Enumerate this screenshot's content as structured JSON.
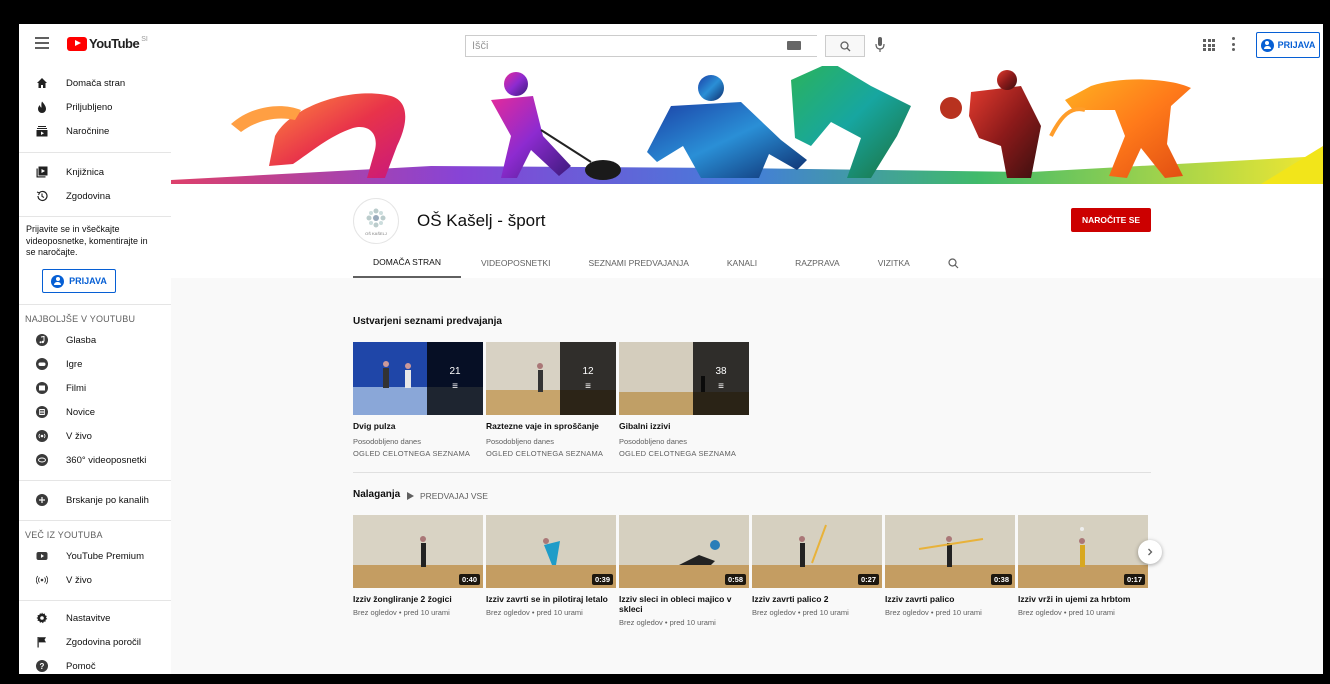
{
  "topbar": {
    "logo_text": "YouTube",
    "logo_sup": "SI",
    "search_placeholder": "Išči",
    "signin_label": "PRIJAVA"
  },
  "sidebar": {
    "main": [
      {
        "label": "Domača stran",
        "icon": "home-icon"
      },
      {
        "label": "Priljubljeno",
        "icon": "trending-icon"
      },
      {
        "label": "Naročnine",
        "icon": "subscriptions-icon"
      }
    ],
    "library": [
      {
        "label": "Knjižnica",
        "icon": "library-icon"
      },
      {
        "label": "Zgodovina",
        "icon": "history-icon"
      }
    ],
    "promo": "Prijavite se in všečkajte videoposnetke, komentirajte in se naročajte.",
    "signin_label": "PRIJAVA",
    "best_heading": "NAJBOLJŠE V YOUTUBU",
    "best": [
      {
        "label": "Glasba"
      },
      {
        "label": "Igre"
      },
      {
        "label": "Filmi"
      },
      {
        "label": "Novice"
      },
      {
        "label": "V živo"
      },
      {
        "label": "360° videoposnetki"
      }
    ],
    "browse_label": "Brskanje po kanalih",
    "more_heading": "VEČ IZ YOUTUBA",
    "more": [
      {
        "label": "YouTube Premium"
      },
      {
        "label": "V živo"
      }
    ],
    "settings": [
      {
        "label": "Nastavitve",
        "icon": "gear-icon"
      },
      {
        "label": "Zgodovina poročil",
        "icon": "flag-icon"
      },
      {
        "label": "Pomoč",
        "icon": "help-icon"
      }
    ]
  },
  "channel": {
    "name": "OŠ Kašelj - šport",
    "avatar_caption": "OŠ KAŠELJ",
    "subscribe_label": "NAROČITE SE",
    "tabs": [
      "DOMAČA STRAN",
      "VIDEOPOSNETKI",
      "SEZNAMI PREDVAJANJA",
      "KANALI",
      "RAZPRAVA",
      "VIZITKA"
    ]
  },
  "playlists_section": {
    "title": "Ustvarjeni seznami predvajanja",
    "items": [
      {
        "title": "Dvig pulza",
        "count": "21",
        "updated": "Posodobljeno danes",
        "link": "OGLED CELOTNEGA SEZNAMA",
        "thumb": "#2a4fa8"
      },
      {
        "title": "Raztezne vaje in sproščanje",
        "count": "12",
        "updated": "Posodobljeno danes",
        "link": "OGLED CELOTNEGA SEZNAMA",
        "thumb": "#b9a98a"
      },
      {
        "title": "Gibalni izzivi",
        "count": "38",
        "updated": "Posodobljeno danes",
        "link": "OGLED CELOTNEGA SEZNAMA",
        "thumb": "#b3a486"
      }
    ]
  },
  "uploads_section": {
    "title": "Nalaganja",
    "play_all": "PREDVAJAJ VSE",
    "items": [
      {
        "title": "Izziv žongliranje 2 žogici",
        "duration": "0:40",
        "meta": "Brez ogledov • pred 10 urami"
      },
      {
        "title": "Izziv zavrti se in pilotiraj letalo",
        "duration": "0:39",
        "meta": "Brez ogledov • pred 10 urami"
      },
      {
        "title": "Izziv sleci in obleci majico v skleci",
        "duration": "0:58",
        "meta": "Brez ogledov • pred 10 urami"
      },
      {
        "title": "Izziv zavrti palico 2",
        "duration": "0:27",
        "meta": "Brez ogledov • pred 10 urami"
      },
      {
        "title": "Izziv zavrti palico",
        "duration": "0:38",
        "meta": "Brez ogledov • pred 10 urami"
      },
      {
        "title": "Izziv vrži in ujemi za hrbtom",
        "duration": "0:17",
        "meta": "Brez ogledov • pred 10 urami"
      }
    ]
  },
  "colors": {
    "brand_red": "#ff0000",
    "subscribe_red": "#cc0000",
    "link_blue": "#065fd4"
  }
}
